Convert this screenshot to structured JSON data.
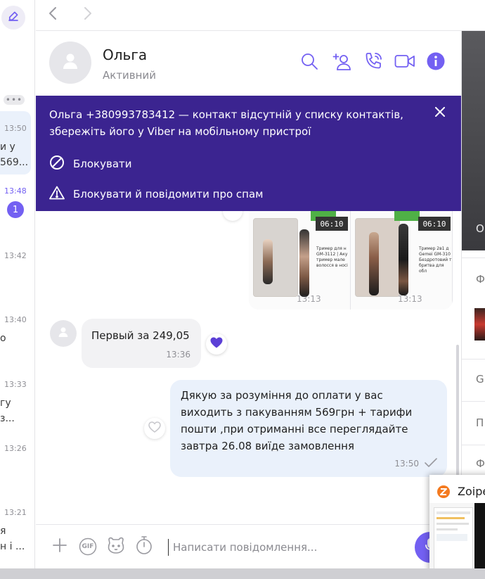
{
  "left_list": {
    "more_dots": "•••",
    "items": [
      {
        "time": "13:50",
        "snippet_lines": [
          "и у",
          "569..."
        ],
        "selected": true
      },
      {
        "time": "13:48",
        "accent": true,
        "unread": "1"
      },
      {
        "time": "13:42"
      },
      {
        "time": "13:40",
        "snippet_lines": [
          "о"
        ]
      },
      {
        "time": "13:33",
        "snippet_lines": [
          "гу",
          "з..."
        ]
      },
      {
        "time": "13:26"
      },
      {
        "time": "13:21",
        "snippet_lines": [
          "я",
          "н і ..."
        ]
      }
    ]
  },
  "header": {
    "name": "Ольга",
    "status": "Активний"
  },
  "banner": {
    "text": "Ольга +380993783412 — контакт відсутній у списку контактів, збережіть його у Viber на мобільному пристрої",
    "block_label": "Блокувати",
    "block_report_label": "Блокувати й повідомити про спам",
    "bg_color": "#3b2490"
  },
  "image_message": {
    "products": [
      {
        "time_display": "06:10",
        "title": "Тример для н GM-3112 | Аку тример мале волосся в носі"
      },
      {
        "time_display": "06:10",
        "title": "Тример 2в1 д Gemei GM-310 Бездротовий т бритва для обл"
      }
    ],
    "time": "13:13"
  },
  "incoming": {
    "text": "Первый за 249,05",
    "time": "13:36"
  },
  "outgoing": {
    "text": "Дякую за розуміння до оплати у вас виходить з пакуванням 569грн + тарифи пошти ,при отриманні все переглядайте завтра 26.08 виїде замовлення",
    "time": "13:50"
  },
  "composer": {
    "placeholder": "Написати повідомлення...",
    "gif_label": "GIF"
  },
  "right_panel": {
    "dark_label": "О",
    "items": [
      "Ф",
      "Gl",
      "П",
      "Ф"
    ]
  },
  "taskbar_popup": {
    "title": "Zoipe"
  },
  "colors": {
    "accent": "#7360f2",
    "outgoing_bubble": "#eaf1fb",
    "incoming_bubble": "#f2f2f4"
  }
}
